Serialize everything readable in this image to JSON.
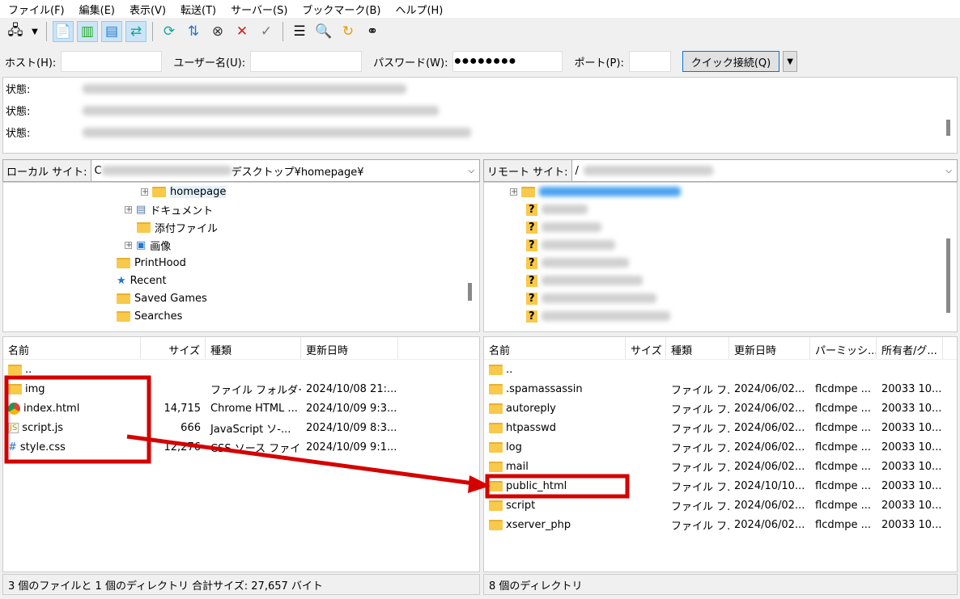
{
  "menu": [
    "ファイル(F)",
    "編集(E)",
    "表示(V)",
    "転送(T)",
    "サーバー(S)",
    "ブックマーク(B)",
    "ヘルプ(H)"
  ],
  "toolbar": {
    "icons": [
      "site-manager-icon",
      "dropdown-icon",
      "message-log-icon",
      "local-tree-icon",
      "remote-tree-icon",
      "transfer-queue-icon",
      "refresh-icon",
      "process-queue-icon",
      "cancel-icon",
      "disconnect-icon",
      "reconnect-icon",
      "directory-listing-filter-icon",
      "compare-icon",
      "sync-browse-icon",
      "search-icon"
    ]
  },
  "quickconnect": {
    "host_label": "ホスト(H):",
    "user_label": "ユーザー名(U):",
    "password_label": "パスワード(W):",
    "password_value": "●●●●●●●●",
    "port_label": "ポート(P):",
    "port_value": "",
    "connect_button": "クイック接続(Q)"
  },
  "log": {
    "rows": [
      "状態:",
      "状態:",
      "状態:"
    ]
  },
  "local": {
    "site_label": "ローカル サイト:",
    "path_prefix": "C",
    "path_suffix": "デスクトップ¥homepage¥",
    "tree": [
      {
        "label": "homepage",
        "icon": "folder",
        "expand": true
      },
      {
        "label": "ドキュメント",
        "icon": "document",
        "expand": true
      },
      {
        "label": "添付ファイル",
        "icon": "folder",
        "expand": false
      },
      {
        "label": "画像",
        "icon": "image",
        "expand": true
      },
      {
        "label": "PrintHood",
        "icon": "folder",
        "expand": false
      },
      {
        "label": "Recent",
        "icon": "recent",
        "expand": false
      },
      {
        "label": "Saved Games",
        "icon": "folder",
        "expand": false
      },
      {
        "label": "Searches",
        "icon": "folder",
        "expand": false
      }
    ],
    "columns": [
      "名前",
      "サイズ",
      "種類",
      "更新日時"
    ],
    "files": [
      {
        "name": "..",
        "size": "",
        "type": "",
        "modified": "",
        "icon": "folder"
      },
      {
        "name": "img",
        "size": "",
        "type": "ファイル フォルダー",
        "modified": "2024/10/08 21:...",
        "icon": "folder"
      },
      {
        "name": "index.html",
        "size": "14,715",
        "type": "Chrome HTML ...",
        "modified": "2024/10/09 9:3...",
        "icon": "chrome"
      },
      {
        "name": "script.js",
        "size": "666",
        "type": "JavaScript ソ-...",
        "modified": "2024/10/09 8:3...",
        "icon": "js"
      },
      {
        "name": "style.css",
        "size": "12,276",
        "type": "CSS ソース ファイル",
        "modified": "2024/10/09 9:1...",
        "icon": "css"
      }
    ],
    "status": "3 個のファイルと 1 個のディレクトリ 合計サイズ: 27,657 バイト"
  },
  "remote": {
    "site_label": "リモート サイト:",
    "path_prefix": "/",
    "columns": [
      "名前",
      "サイズ",
      "種類",
      "更新日時",
      "パーミッシ...",
      "所有者/グ..."
    ],
    "files": [
      {
        "name": "..",
        "type": "",
        "modified": "",
        "perm": "",
        "owner": ""
      },
      {
        "name": ".spamassassin",
        "type": "ファイル フ...",
        "modified": "2024/06/02...",
        "perm": "flcdmpe ...",
        "owner": "20033 10..."
      },
      {
        "name": "autoreply",
        "type": "ファイル フ...",
        "modified": "2024/06/02...",
        "perm": "flcdmpe ...",
        "owner": "20033 10..."
      },
      {
        "name": "htpasswd",
        "type": "ファイル フ...",
        "modified": "2024/06/02...",
        "perm": "flcdmpe ...",
        "owner": "20033 10..."
      },
      {
        "name": "log",
        "type": "ファイル フ...",
        "modified": "2024/06/02...",
        "perm": "flcdmpe ...",
        "owner": "20033 10..."
      },
      {
        "name": "mail",
        "type": "ファイル フ...",
        "modified": "2024/06/02...",
        "perm": "flcdmpe ...",
        "owner": "20033 10..."
      },
      {
        "name": "public_html",
        "type": "ファイル フ...",
        "modified": "2024/10/10...",
        "perm": "flcdmpe ...",
        "owner": "20033 10..."
      },
      {
        "name": "script",
        "type": "ファイル フ...",
        "modified": "2024/06/02...",
        "perm": "flcdmpe ...",
        "owner": "20033 10..."
      },
      {
        "name": "xserver_php",
        "type": "ファイル フ...",
        "modified": "2024/06/02...",
        "perm": "flcdmpe ...",
        "owner": "20033 10..."
      }
    ],
    "status": "8 個のディレクトリ"
  },
  "colors": {
    "annotation": "#d40000",
    "selection": "#cce4f7",
    "folder": "#f8c94a"
  }
}
